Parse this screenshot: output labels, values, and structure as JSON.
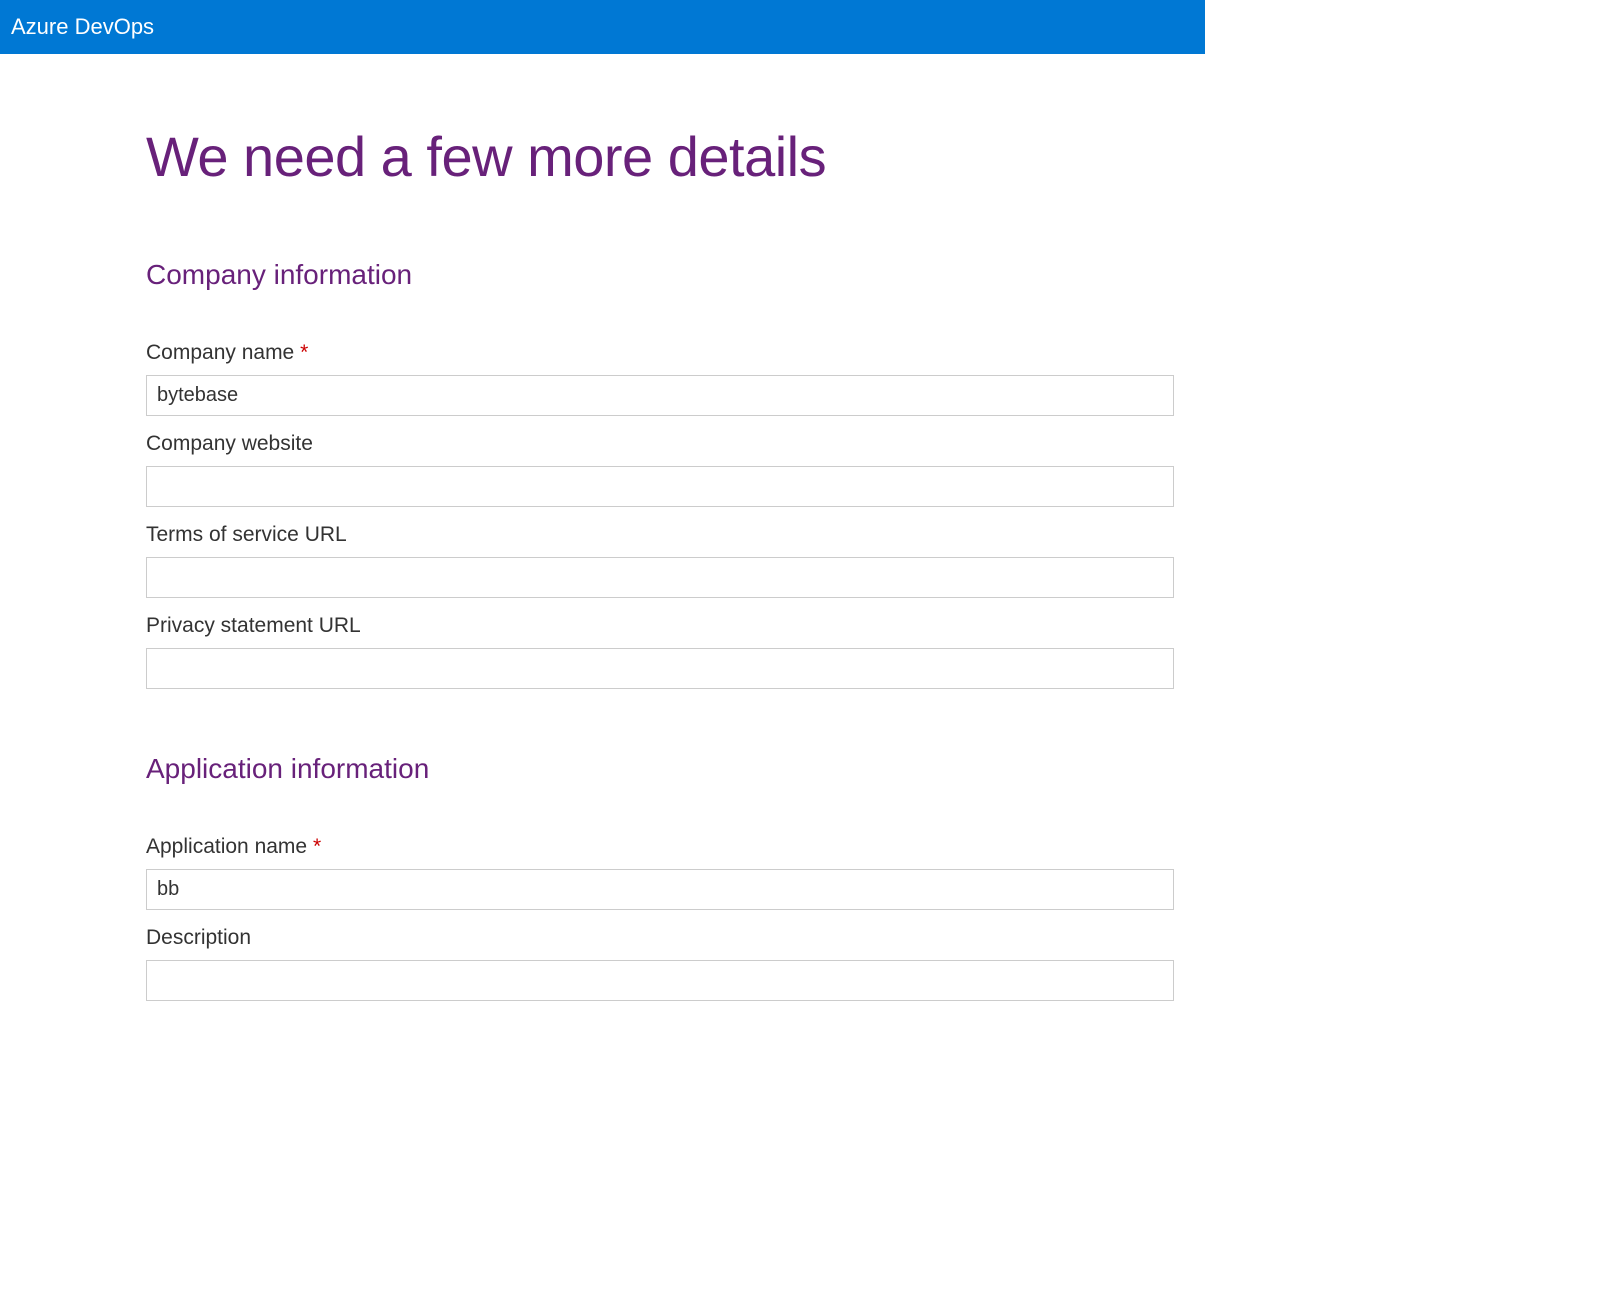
{
  "header": {
    "title": "Azure DevOps"
  },
  "page": {
    "title": "We need a few more details"
  },
  "sections": {
    "company": {
      "title": "Company information",
      "fields": {
        "name": {
          "label": "Company name",
          "required": true,
          "value": "bytebase"
        },
        "website": {
          "label": "Company website",
          "required": false,
          "value": ""
        },
        "tos": {
          "label": "Terms of service URL",
          "required": false,
          "value": ""
        },
        "privacy": {
          "label": "Privacy statement URL",
          "required": false,
          "value": ""
        }
      }
    },
    "application": {
      "title": "Application information",
      "fields": {
        "name": {
          "label": "Application name",
          "required": true,
          "value": "bb"
        },
        "description": {
          "label": "Description",
          "required": false,
          "value": ""
        }
      }
    }
  }
}
